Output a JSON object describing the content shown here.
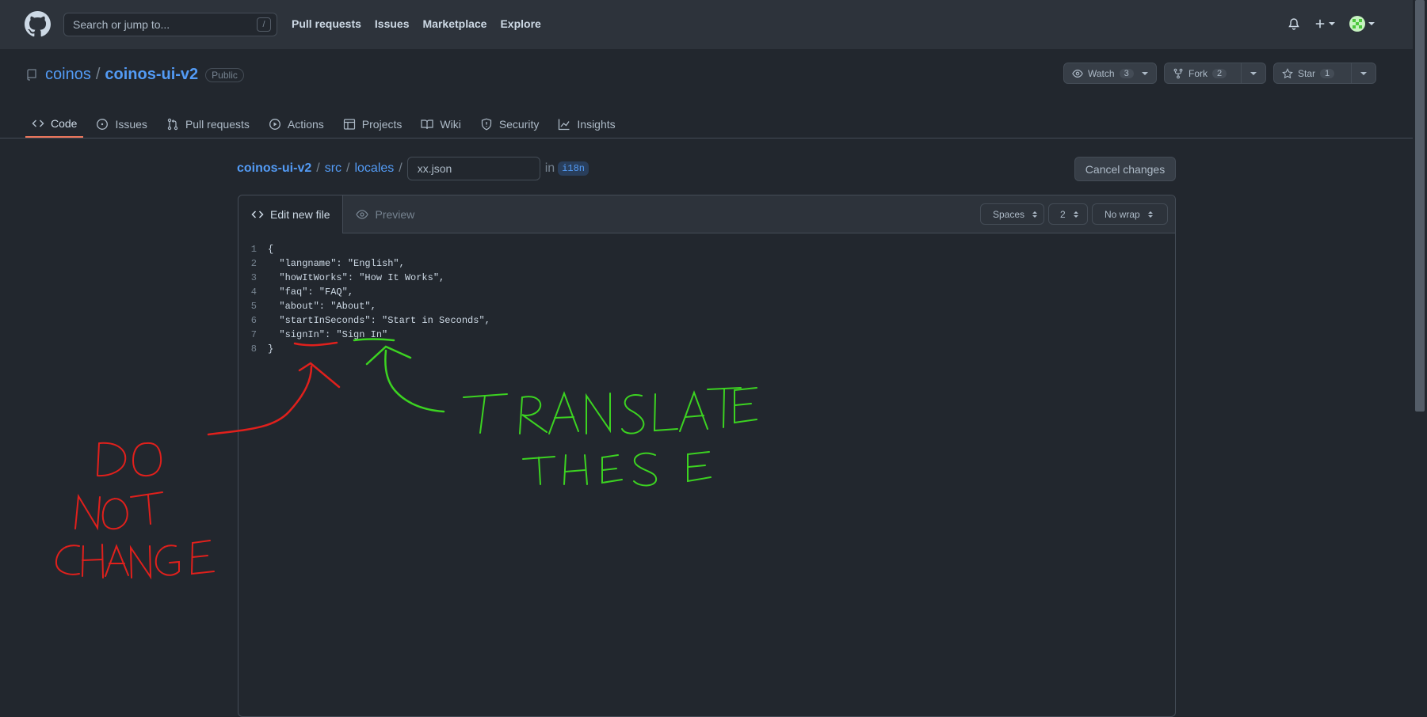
{
  "header": {
    "search_placeholder": "Search or jump to...",
    "search_hotkey": "/",
    "nav": [
      "Pull requests",
      "Issues",
      "Marketplace",
      "Explore"
    ]
  },
  "repo": {
    "owner": "coinos",
    "name": "coinos-ui-v2",
    "visibility": "Public",
    "watch": {
      "label": "Watch",
      "count": "3"
    },
    "fork": {
      "label": "Fork",
      "count": "2"
    },
    "star": {
      "label": "Star",
      "count": "1"
    },
    "tabs": [
      {
        "label": "Code",
        "icon": "code-icon"
      },
      {
        "label": "Issues",
        "icon": "issue-icon"
      },
      {
        "label": "Pull requests",
        "icon": "pull-request-icon"
      },
      {
        "label": "Actions",
        "icon": "play-icon"
      },
      {
        "label": "Projects",
        "icon": "table-icon"
      },
      {
        "label": "Wiki",
        "icon": "book-icon"
      },
      {
        "label": "Security",
        "icon": "shield-icon"
      },
      {
        "label": "Insights",
        "icon": "graph-icon"
      }
    ]
  },
  "editor": {
    "path": [
      "coinos-ui-v2",
      "src",
      "locales"
    ],
    "filename": "xx.json",
    "in_label": "in",
    "branch": "i18n",
    "cancel_label": "Cancel changes",
    "tab_edit": "Edit new file",
    "tab_preview": "Preview",
    "indent_mode": "Spaces",
    "indent_size": "2",
    "wrap_mode": "No wrap",
    "lines": [
      {
        "num": "1",
        "text": "{"
      },
      {
        "num": "2",
        "text": "  \"langname\": \"English\","
      },
      {
        "num": "3",
        "text": "  \"howItWorks\": \"How It Works\","
      },
      {
        "num": "4",
        "text": "  \"faq\": \"FAQ\","
      },
      {
        "num": "5",
        "text": "  \"about\": \"About\","
      },
      {
        "num": "6",
        "text": "  \"startInSeconds\": \"Start in Seconds\","
      },
      {
        "num": "7",
        "text": "  \"signIn\": \"Sign In\""
      },
      {
        "num": "8",
        "text": "}"
      }
    ]
  },
  "annotations": {
    "do_not_change": [
      "DO",
      "NOT",
      "CHANGE"
    ],
    "translate_these": [
      "TRANSLATE",
      "THESE"
    ],
    "red": "#e0201c",
    "green": "#3cd321"
  },
  "colors": {
    "background": "#22272e",
    "header": "#2d333b",
    "link": "#539bf5",
    "active_tab_underline": "#ec775c"
  }
}
